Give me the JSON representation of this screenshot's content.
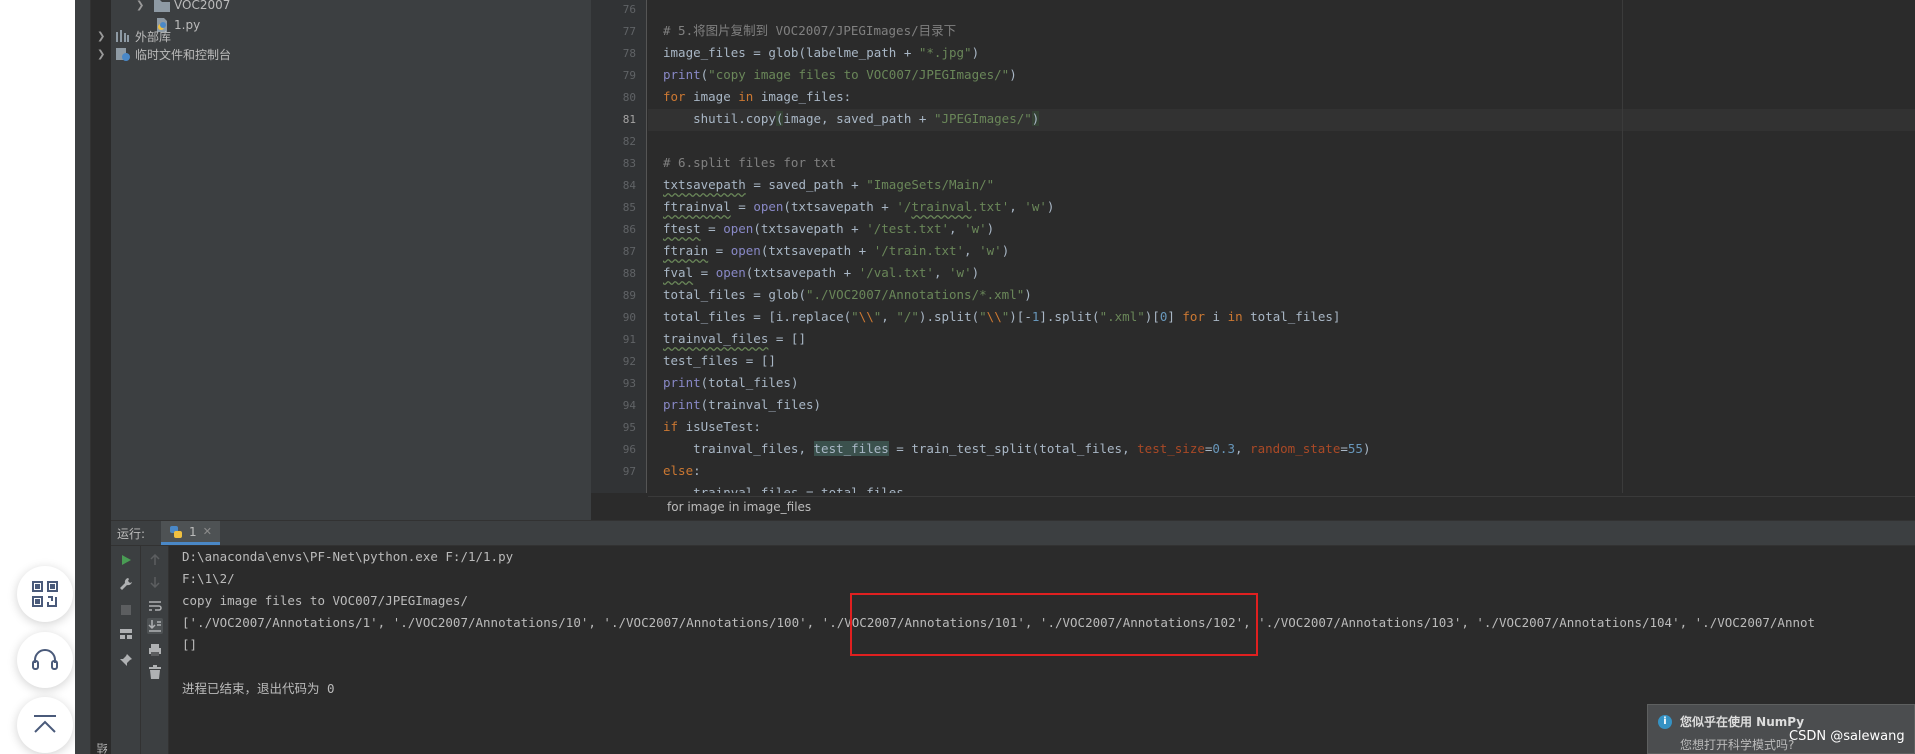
{
  "project_tree": {
    "items": [
      {
        "label": "VOC2007",
        "type": "folder",
        "expanded": false
      },
      {
        "label": "1.py",
        "type": "python-file"
      },
      {
        "label": "外部库",
        "type": "library"
      },
      {
        "label": "临时文件和控制台",
        "type": "scratches"
      }
    ]
  },
  "editor": {
    "line_numbers": [
      "76",
      "77",
      "78",
      "79",
      "80",
      "81",
      "82",
      "83",
      "84",
      "85",
      "86",
      "87",
      "88",
      "89",
      "90",
      "91",
      "92",
      "93",
      "94",
      "95",
      "96",
      "97"
    ],
    "current_line": "81",
    "breadcrumb": "for image in image_files"
  },
  "run": {
    "title": "运行:",
    "tab_label": "1",
    "output": [
      "D:\\anaconda\\envs\\PF-Net\\python.exe F:/1/1.py",
      "F:\\1\\2/",
      "copy image files to VOC007/JPEGImages/",
      "['./VOC2007/Annotations/1', './VOC2007/Annotations/10', './VOC2007/Annotations/100', './VOC2007/Annotations/101', './VOC2007/Annotations/102', './VOC2007/Annotations/103', './VOC2007/Annotations/104', './VOC2007/Annot",
      "[]",
      "",
      "进程已结束，退出代码为 0"
    ]
  },
  "notification": {
    "title": "您似乎在使用 NumPy",
    "body": "您想打开科学模式吗?"
  },
  "watermark": "CSDN @salewang",
  "side_label": "结构",
  "colors": {
    "highlight_box": "#e02020",
    "accent": "#4a88c7"
  }
}
